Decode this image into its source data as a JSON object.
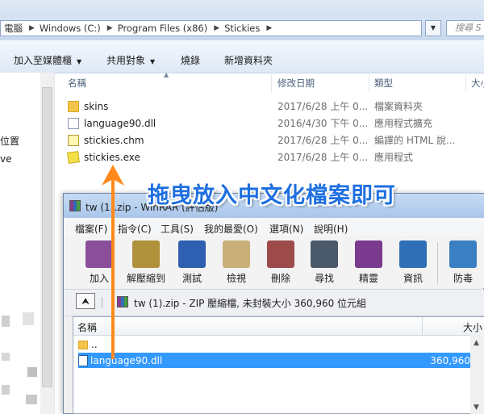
{
  "explorer": {
    "breadcrumb": [
      "電腦",
      "Windows (C:)",
      "Program Files (x86)",
      "Stickies"
    ],
    "search_placeholder": "搜尋 S",
    "toolbar": {
      "add_to_media": "加入至媒體櫃",
      "share_with": "共用對象",
      "burn": "燒錄",
      "new_folder": "新增資料夾"
    },
    "nav_labels": [
      "位置",
      "ve"
    ],
    "columns": {
      "name": "名稱",
      "date": "修改日期",
      "type": "類型",
      "size": "大小"
    },
    "files": [
      {
        "name": "skins",
        "date": "2017/6/28 上午 0...",
        "type": "檔案資料夾",
        "icon": "folder-icon"
      },
      {
        "name": "language90.dll",
        "date": "2016/4/30 下午 0...",
        "type": "應用程式擴充",
        "icon": "dll-file-icon"
      },
      {
        "name": "stickies.chm",
        "date": "2017/6/28 上午 0...",
        "type": "編譯的 HTML 說...",
        "icon": "chm-file-icon"
      },
      {
        "name": "stickies.exe",
        "date": "2017/6/28 上午 0...",
        "type": "應用程式",
        "icon": "exe-file-icon"
      }
    ]
  },
  "annotation": "拖曳放入中文化檔案即可",
  "winrar": {
    "title": "tw (1).zip - WinRAR (評估版)",
    "menu": [
      "檔案(F)",
      "指令(C)",
      "工具(S)",
      "我的最愛(O)",
      "選項(N)",
      "說明(H)"
    ],
    "tools": [
      {
        "label": "加入",
        "icon": "add-archive-icon",
        "color": "#8a4e9a"
      },
      {
        "label": "解壓縮到",
        "icon": "extract-to-icon",
        "color": "#b0913b"
      },
      {
        "label": "測試",
        "icon": "test-icon",
        "color": "#2f5fb0"
      },
      {
        "label": "檢視",
        "icon": "view-icon",
        "color": "#c9b07a"
      },
      {
        "label": "刪除",
        "icon": "delete-icon",
        "color": "#9c4a4a"
      },
      {
        "label": "尋找",
        "icon": "find-icon",
        "color": "#4a5a6a"
      },
      {
        "label": "精靈",
        "icon": "wizard-icon",
        "color": "#7a3b8e"
      },
      {
        "label": "資訊",
        "icon": "info-icon",
        "color": "#2e6fb5"
      },
      {
        "label": "防毒",
        "icon": "antivirus-icon",
        "color": "#3a7fc2"
      }
    ],
    "path_text": "tw (1).zip - ZIP 壓縮檔, 未封裝大小 360,960 位元組",
    "list_columns": {
      "name": "名稱",
      "size": "大小"
    },
    "items": [
      {
        "name": "..",
        "size": ""
      },
      {
        "name": "language90.dll",
        "size": "360,960"
      }
    ]
  }
}
